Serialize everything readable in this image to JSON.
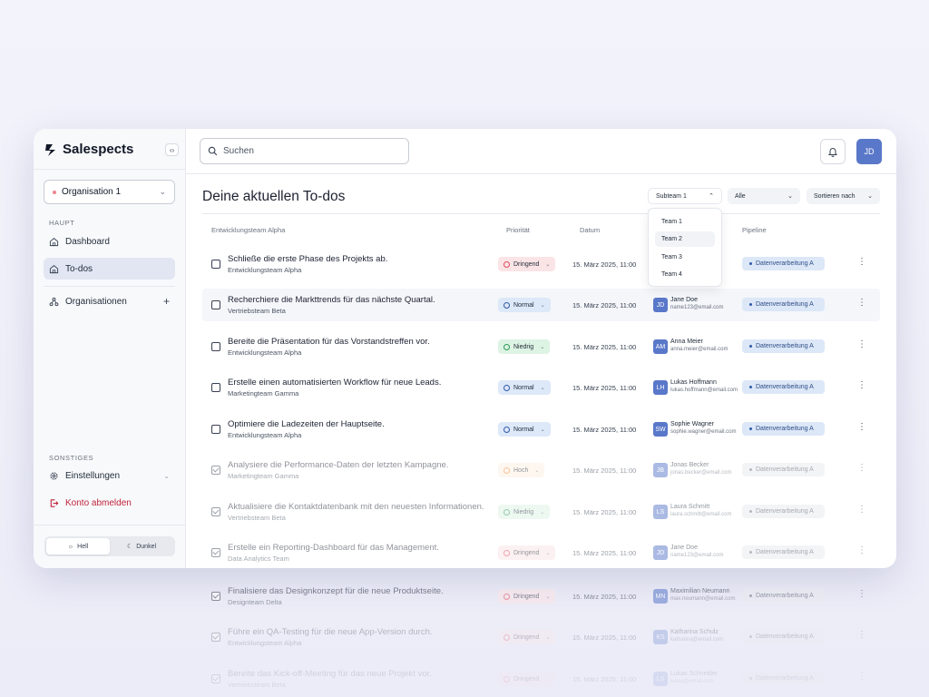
{
  "app": {
    "name": "Salespects"
  },
  "sidebar": {
    "org_select": "Organisation 1",
    "section_main": "HAUPT",
    "items": [
      {
        "label": "Dashboard"
      },
      {
        "label": "To-dos"
      },
      {
        "label": "Organisationen"
      }
    ],
    "section_other": "SONSTIGES",
    "settings": "Einstellungen",
    "logout": "Konto abmelden",
    "theme": {
      "light": "Hell",
      "dark": "Dunkel"
    }
  },
  "search": {
    "placeholder": "Suchen"
  },
  "user": {
    "initials": "JD"
  },
  "page_title": "Deine aktuellen To-dos",
  "filters": {
    "subteam": "Subteam 1",
    "all": "Alle",
    "sort": "Sortieren nach"
  },
  "dropdown": [
    "Team 1",
    "Team 2",
    "Team 3",
    "Team 4"
  ],
  "table": {
    "headers": {
      "group": "Entwicklungsteam Alpha",
      "priority": "Priorität",
      "date": "Datum",
      "pipeline": "Pipeline"
    },
    "rows": [
      {
        "title": "Schließe die erste Phase des Projekts ab.",
        "team": "Entwicklungsteam Alpha",
        "priority": "Dringend",
        "date": "15. März 2025, 11:00",
        "initials": "",
        "name": "",
        "email": "",
        "pipeline": "Datenverarbeitung A"
      },
      {
        "title": "Recherchiere die Markttrends für das nächste Quartal.",
        "team": "Vertriebsteam Beta",
        "priority": "Normal",
        "date": "15. März 2025, 11:00",
        "initials": "JD",
        "name": "Jane Doe",
        "email": "name123@email.com",
        "pipeline": "Datenverarbeitung A"
      },
      {
        "title": "Bereite die Präsentation für das Vorstandstreffen vor.",
        "team": "Entwicklungsteam Alpha",
        "priority": "Niedrig",
        "date": "15. März 2025, 11:00",
        "initials": "AM",
        "name": "Anna Meier",
        "email": "anna.meier@email.com",
        "pipeline": "Datenverarbeitung A"
      },
      {
        "title": "Erstelle einen automatisierten Workflow für neue Leads.",
        "team": "Marketingteam Gamma",
        "priority": "Normal",
        "date": "15. März 2025, 11:00",
        "initials": "LH",
        "name": "Lukas Hoffmann",
        "email": "lukas.hoffmann@email.com",
        "pipeline": "Datenverarbeitung A"
      },
      {
        "title": "Optimiere die Ladezeiten der Hauptseite.",
        "team": "Entwicklungsteam Alpha",
        "priority": "Normal",
        "date": "15. März 2025, 11:00",
        "initials": "SW",
        "name": "Sophie Wagner",
        "email": "sophie.wagner@email.com",
        "pipeline": "Datenverarbeitung A"
      },
      {
        "title": "Analysiere die Performance-Daten der letzten Kampagne.",
        "team": "Marketingteam Gamma",
        "priority": "Hoch",
        "date": "15. März 2025, 11:00",
        "initials": "JB",
        "name": "Jonas Becker",
        "email": "jonas.becker@email.com",
        "pipeline": "Datenverarbeitung A"
      },
      {
        "title": "Aktualisiere die Kontaktdatenbank mit den neuesten Informationen.",
        "team": "Vertriebsteam Beta",
        "priority": "Niedrig",
        "date": "15. März 2025, 11:00",
        "initials": "LS",
        "name": "Laura Schmitt",
        "email": "laura.schmitt@email.com",
        "pipeline": "Datenverarbeitung A"
      },
      {
        "title": "Erstelle ein Reporting-Dashboard für das Management.",
        "team": "Data Analytics Team",
        "priority": "Dringend",
        "date": "15. März 2025, 11:00",
        "initials": "JD",
        "name": "Jane Doe",
        "email": "name123@email.com",
        "pipeline": "Datenverarbeitung A"
      }
    ],
    "ghost_rows": [
      {
        "title": "Finalisiere das Designkonzept für die neue Produktseite.",
        "team": "Designteam Delta",
        "priority": "Dringend",
        "date": "15. März 2025, 11:00",
        "initials": "MN",
        "name": "Maximilian Neumann",
        "email": "max.neumann@email.com",
        "pipeline": "Datenverarbeitung A"
      },
      {
        "title": "Führe ein QA-Testing für die neue App-Version durch.",
        "team": "Entwicklungsteam Alpha",
        "priority": "Dringend",
        "date": "15. März 2025, 11:00",
        "initials": "KS",
        "name": "Katharina Schulz",
        "email": "katharina@email.com",
        "pipeline": "Datenverarbeitung A"
      },
      {
        "title": "Bereite das Kick-off-Meeting für das neue Projekt vor.",
        "team": "Vertriebsteam Beta",
        "priority": "Dringend",
        "date": "15. März 2025, 11:00",
        "initials": "LS",
        "name": "Lukas Schneider",
        "email": "lukas@email.com",
        "pipeline": "Datenverarbeitung A"
      }
    ]
  }
}
